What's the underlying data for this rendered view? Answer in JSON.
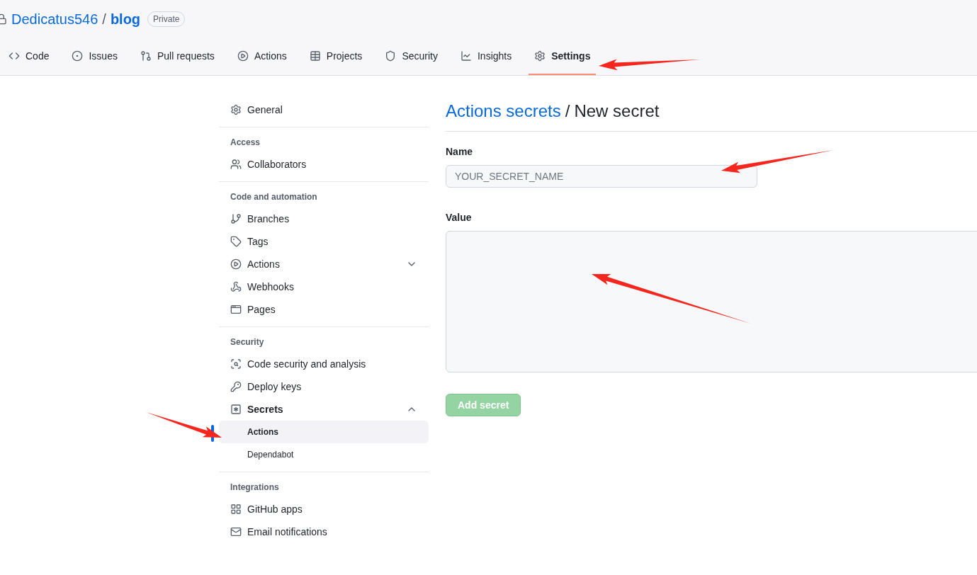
{
  "repo": {
    "owner": "Dedicatus546",
    "separator": "/",
    "name": "blog",
    "visibility": "Private"
  },
  "tabs": [
    {
      "label": "Code",
      "selected": false
    },
    {
      "label": "Issues",
      "selected": false
    },
    {
      "label": "Pull requests",
      "selected": false
    },
    {
      "label": "Actions",
      "selected": false
    },
    {
      "label": "Projects",
      "selected": false
    },
    {
      "label": "Security",
      "selected": false
    },
    {
      "label": "Insights",
      "selected": false
    },
    {
      "label": "Settings",
      "selected": true
    }
  ],
  "sidebar": {
    "sections": [
      {
        "items": [
          {
            "label": "General",
            "selected": false
          }
        ]
      },
      {
        "heading": "Access",
        "items": [
          {
            "label": "Collaborators",
            "selected": false
          }
        ]
      },
      {
        "heading": "Code and automation",
        "items": [
          {
            "label": "Branches",
            "selected": false
          },
          {
            "label": "Tags",
            "selected": false
          },
          {
            "label": "Actions",
            "selected": false,
            "expanded": false
          },
          {
            "label": "Webhooks",
            "selected": false
          },
          {
            "label": "Pages",
            "selected": false
          }
        ]
      },
      {
        "heading": "Security",
        "items": [
          {
            "label": "Code security and analysis",
            "selected": false
          },
          {
            "label": "Deploy keys",
            "selected": false
          },
          {
            "label": "Secrets",
            "selected": false,
            "expanded": true,
            "children": [
              {
                "label": "Actions",
                "selected": true
              },
              {
                "label": "Dependabot",
                "selected": false
              }
            ]
          }
        ]
      },
      {
        "heading": "Integrations",
        "items": [
          {
            "label": "GitHub apps",
            "selected": false
          },
          {
            "label": "Email notifications",
            "selected": false
          }
        ]
      }
    ]
  },
  "main": {
    "breadcrumb": "Actions secrets",
    "separator": "/",
    "title": "New secret",
    "name_field": {
      "label": "Name",
      "placeholder": "YOUR_SECRET_NAME"
    },
    "value_field": {
      "label": "Value"
    },
    "submit": {
      "label": "Add secret",
      "disabled": true
    }
  }
}
